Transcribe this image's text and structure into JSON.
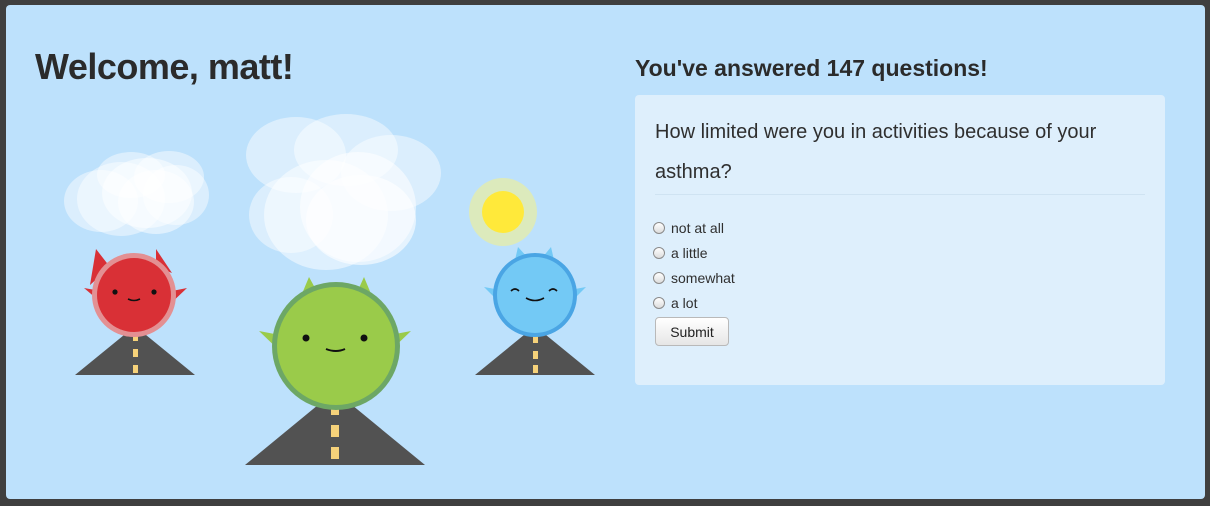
{
  "welcome": "Welcome, matt!",
  "answered": "You've answered 147 questions!",
  "question": "How limited were you in activities because of your asthma?",
  "options": [
    "not at all",
    "a little",
    "somewhat",
    "a lot"
  ],
  "submit_label": "Submit",
  "colors": {
    "background": "#bde1fc",
    "card": "#deeffc",
    "red_monster": "#d93036",
    "green_monster": "#9acb4a",
    "blue_monster": "#73c9f5",
    "road": "#525252",
    "road_stripe": "#f6d27a",
    "sun": "#ffe93a"
  },
  "illustration": {
    "monsters": [
      "red-monster-icon",
      "green-monster-icon",
      "blue-monster-icon"
    ],
    "extras": [
      "cloud-icon",
      "cloud-icon",
      "sun-icon",
      "road-icon"
    ]
  }
}
